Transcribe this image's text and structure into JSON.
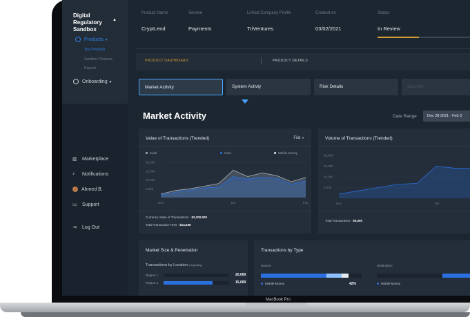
{
  "sidebar": {
    "brand": "Digital Regulatory Sandbox",
    "products_label": "Products",
    "sub_items": [
      "Test Products",
      "Sandbox Products",
      "Reports"
    ],
    "onboarding_label": "Onboarding",
    "bottom_items": [
      "Marketplace",
      "Notifications",
      "Ahmed B.",
      "Support"
    ],
    "logout_label": "Log Out"
  },
  "header": {
    "labels": [
      "Product Name",
      "Service",
      "Linked Company Profile",
      "Created on",
      "Status"
    ],
    "values": [
      "CryptLend",
      "Payments",
      "TriVentures",
      "03/02/2021",
      "In Review"
    ],
    "status_progress": 0.45
  },
  "tabs": [
    "PRODUCT DASHBOARD",
    "PRODUCT DETAILS"
  ],
  "subtabs": [
    "Market Activity",
    "System Activty",
    "Risk Details",
    "Security"
  ],
  "page_title": "Market Activity",
  "date_range": {
    "label": "Date Range",
    "value": "Dec 28 2021 - Feb 3"
  },
  "card1": {
    "title": "Value of Transactions (Trended)",
    "dropdown": "Fiat",
    "footer_line1_label": "Currency Value of Transactions - ",
    "footer_line1_value": "$2,300,000",
    "footer_line2_label": "Total Transaction Fees - ",
    "footer_line2_value": "$14,538"
  },
  "card2": {
    "title": "Volume of Transactions (Trended)",
    "footer_label": "Total Transactions - ",
    "footer_value": "50,000"
  },
  "card3": {
    "title": "Market Size & Penetration",
    "subtitle": "Transactions by Location",
    "subtitle_note": "(Originating)",
    "rows": [
      {
        "label": "Region 1",
        "value": "20,000",
        "fraction": 0.0
      },
      {
        "label": "Region 2",
        "value": "15,000",
        "fraction": 0.75
      }
    ]
  },
  "card4": {
    "title": "Transactions by Type",
    "source_label": "Source",
    "destination_label": "Destination",
    "source_item": "Mobile Money",
    "source_pct": "42%",
    "dest_item": "Mobile Money"
  },
  "laptop_label": "MacBook Pro",
  "chart_data": [
    {
      "type": "area",
      "title": "Value of Transactions (Trended)",
      "x_ticks": [
        "Dec",
        "Jan",
        "Feb"
      ],
      "y_ticks": [
        "20,000",
        "15,000",
        "10,000",
        "5,000"
      ],
      "ylim": [
        0,
        22000
      ],
      "legend": [
        "Cash",
        "Card",
        "Mobile Money"
      ],
      "legend_position": "top",
      "series": [
        {
          "name": "Cash",
          "values": [
            2000,
            4000,
            5000,
            6500,
            8000,
            15500,
            12000,
            14000,
            12500,
            9000,
            11500
          ],
          "color": "#a7b3bf"
        },
        {
          "name": "Card",
          "values": [
            1500,
            3000,
            4200,
            5500,
            6000,
            12000,
            10500,
            11500,
            11000,
            7500,
            9500
          ],
          "color": "#2b6fe0"
        },
        {
          "name": "Mobile Money",
          "values": [
            1000,
            2500,
            3500,
            4500,
            5000,
            9000,
            9000,
            10000,
            9500,
            6500,
            8500
          ],
          "color": "#4b6078"
        }
      ]
    },
    {
      "type": "area",
      "title": "Volume of Transactions (Trended)",
      "x_ticks": [
        "Dec",
        "Jan"
      ],
      "y_ticks": [
        "20,000",
        "15,000",
        "10,000",
        "5,000"
      ],
      "ylim": [
        0,
        22000
      ],
      "series": [
        {
          "values": [
            2000,
            3500,
            5000,
            6500,
            7000,
            15000,
            14000,
            14000
          ],
          "color": "#2b6fe0"
        }
      ]
    }
  ],
  "colors": {
    "accent": "#2f7ee6",
    "status": "#d49a33",
    "background": "#1c2631"
  }
}
